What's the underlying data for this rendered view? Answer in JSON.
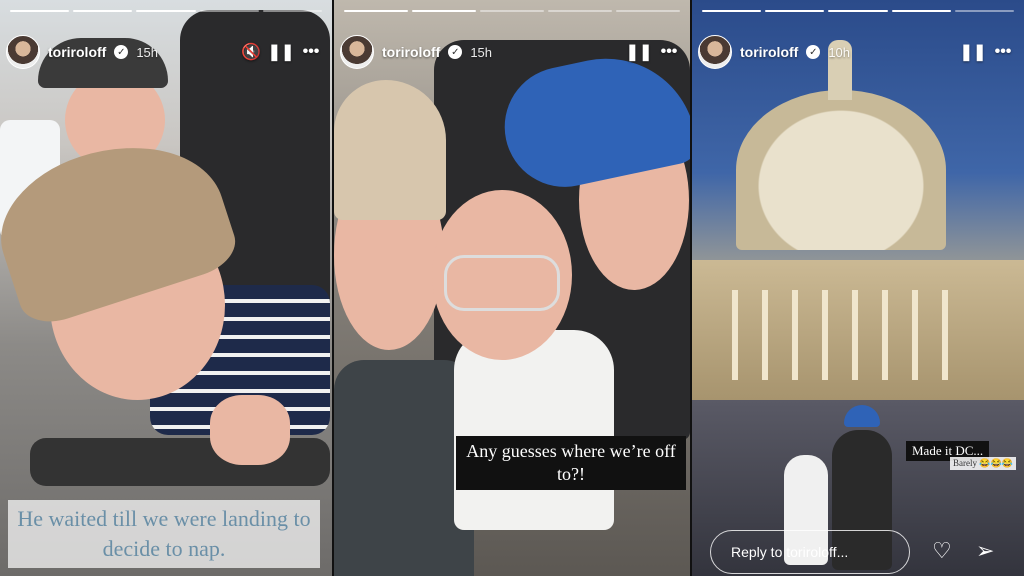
{
  "stories": [
    {
      "username": "toriroloff",
      "time": "15h",
      "caption": "He waited till we were landing to decide to nap."
    },
    {
      "username": "toriroloff",
      "time": "15h",
      "caption": "Any guesses where we’re off to?!"
    },
    {
      "username": "toriroloff",
      "time": "10h",
      "caption_main": "Made it DC...",
      "caption_sub": "Barely 😂😂😂",
      "reply_placeholder": "Reply to toriroloff..."
    }
  ],
  "icons": {
    "verified": "verified-badge-icon",
    "mute": "muted-speaker-icon",
    "pause": "pause-icon",
    "more": "more-options-icon",
    "like": "heart-icon",
    "share": "send-icon"
  }
}
